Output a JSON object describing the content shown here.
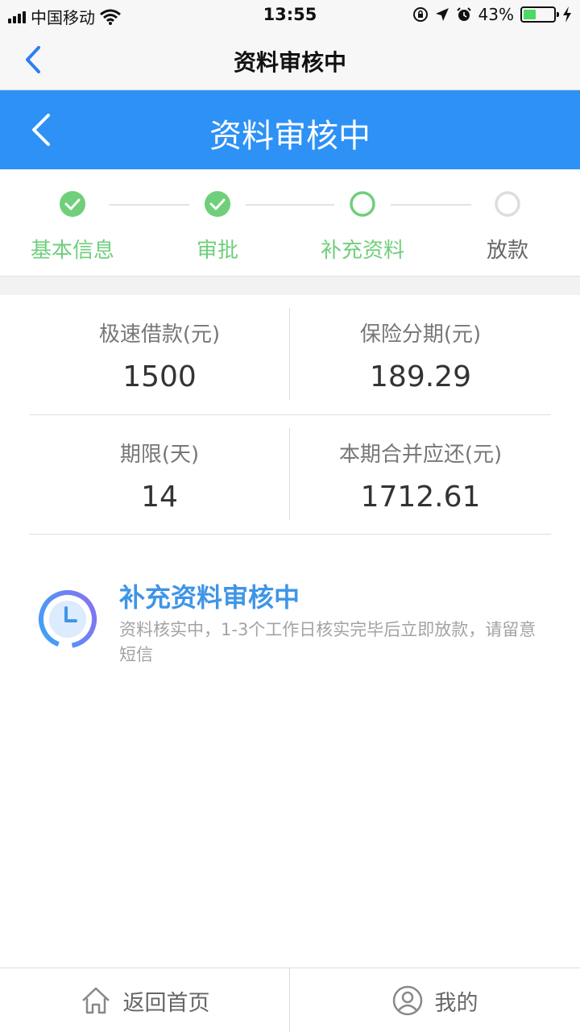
{
  "status_bar": {
    "carrier": "中国移动",
    "time": "13:55",
    "battery_percent": "43%",
    "battery_level": 0.43,
    "battery_color": "#4cd964"
  },
  "nav_bar": {
    "title": "资料审核中",
    "back_icon": "chevron-left-icon"
  },
  "header": {
    "title": "资料审核中",
    "back_icon": "chevron-left-icon",
    "background": "#2d91f5"
  },
  "steps": [
    {
      "label": "基本信息",
      "state": "done"
    },
    {
      "label": "审批",
      "state": "done"
    },
    {
      "label": "补充资料",
      "state": "current"
    },
    {
      "label": "放款",
      "state": "pending"
    }
  ],
  "info": {
    "loan_amount": {
      "label": "极速借款(元)",
      "value": "1500"
    },
    "insurance": {
      "label": "保险分期(元)",
      "value": "189.29"
    },
    "term": {
      "label": "期限(天)",
      "value": "14"
    },
    "repayment": {
      "label": "本期合并应还(元)",
      "value": "1712.61"
    }
  },
  "notice": {
    "icon": "clock-icon",
    "title": "补充资料审核中",
    "description": "资料核实中，1-3个工作日核实完毕后立即放款，请留意短信"
  },
  "bottom_bar": {
    "home": {
      "label": "返回首页",
      "icon": "home-icon"
    },
    "mine": {
      "label": "我的",
      "icon": "user-icon"
    }
  },
  "colors": {
    "accent_blue": "#2d91f5",
    "step_done_green": "#6fcf7b",
    "notice_title_blue": "#3f95e6"
  }
}
